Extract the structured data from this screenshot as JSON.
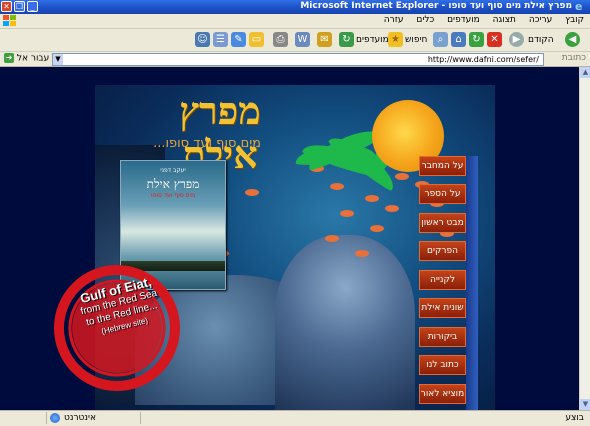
{
  "window": {
    "title": "מפרץ אילת מים סוף ועד סופו - Microsoft Internet Explorer",
    "close_glyph": "✕",
    "restore_glyph": "❐",
    "minimize_glyph": "_"
  },
  "menu": {
    "items": [
      "קובץ",
      "עריכה",
      "תצוגה",
      "מועדפים",
      "כלים",
      "עזרה"
    ]
  },
  "toolbar": {
    "back_label": "הקודם",
    "search_label": "חיפוש",
    "favorites_label": "מועדפים"
  },
  "addressbar": {
    "label": "כתובת",
    "url": "http://www.dafni.com/sefer/",
    "go_label": "עבור אל"
  },
  "page": {
    "heading": "מפרץ אילת",
    "subheading": "מים סוף ועד סופו...",
    "book": {
      "author": "יעקב דפני",
      "title": "מפרץ אילת",
      "subtitle": "מים סוף ועד סופו"
    },
    "nav": [
      {
        "label": "על המחבר"
      },
      {
        "label": "על הספר"
      },
      {
        "label": "מבט ראשון"
      },
      {
        "label": "הפרקים"
      },
      {
        "label": "לקנייה"
      },
      {
        "label": "שונית אילת"
      },
      {
        "label": "ביקורות"
      },
      {
        "label": "כתוב לנו"
      },
      {
        "label": "מוציא לאור"
      }
    ],
    "stamp": {
      "line1": "Gulf of Eiat,",
      "line2": "from the Red Sea",
      "line3": "to the Red line...",
      "line4": "(Hebrew site)"
    }
  },
  "statusbar": {
    "status": "בוצע",
    "zone": "אינטרנט"
  },
  "colors": {
    "page_bg": "#000b3d",
    "heading": "#f3c233",
    "nav_button": "#b03a14",
    "stamp_red": "#d5161e"
  }
}
